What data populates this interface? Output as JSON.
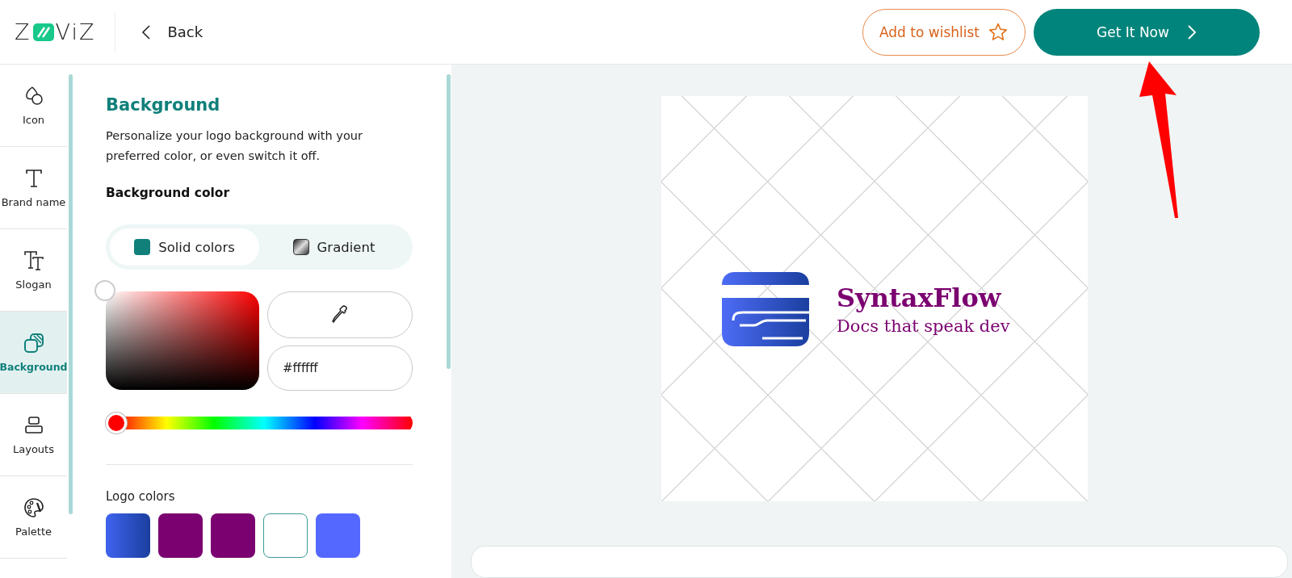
{
  "header": {
    "logo": {
      "left": "Z",
      "right": "ViZ"
    },
    "back": "Back",
    "wishlist": "Add to wishlist",
    "cta": "Get It Now"
  },
  "nav": [
    {
      "label": "Icon",
      "kind": "shapes",
      "selected": false
    },
    {
      "label": "Brand name",
      "kind": "text",
      "selected": false
    },
    {
      "label": "Slogan",
      "kind": "slogan",
      "selected": false
    },
    {
      "label": "Background",
      "kind": "background",
      "selected": true
    },
    {
      "label": "Layouts",
      "kind": "layouts",
      "selected": false
    },
    {
      "label": "Palette",
      "kind": "palette",
      "selected": false
    }
  ],
  "panel": {
    "title": "Background",
    "description": "Personalize your logo background with your preferred color, or even switch it off.",
    "section": "Background color",
    "tabs": [
      {
        "label": "Solid colors",
        "kind": "solid",
        "selected": true
      },
      {
        "label": "Gradient",
        "kind": "gradient",
        "selected": false
      }
    ],
    "hex": "#ffffff",
    "hue": {
      "level": 0
    },
    "logo_colors_label": "Logo colors",
    "swatches": [
      {
        "kind": "gradient",
        "color": "#3f63ee",
        "selected": false
      },
      {
        "kind": "solid",
        "color": "#7b0170",
        "selected": false
      },
      {
        "kind": "solid",
        "color": "#7b0170",
        "selected": false
      },
      {
        "kind": "solid",
        "color": "#ffffff",
        "selected": true
      },
      {
        "kind": "solid",
        "color": "#5468ff",
        "selected": false
      }
    ]
  },
  "preview": {
    "brand": "SyntaxFlow",
    "slogan": "Docs that speak dev"
  }
}
